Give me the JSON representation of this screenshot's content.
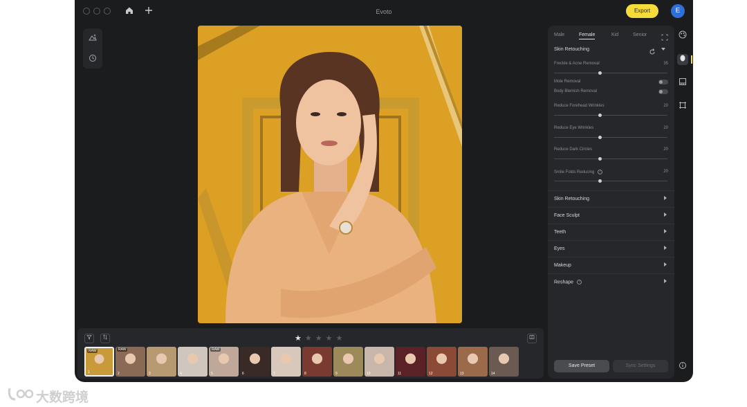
{
  "window": {
    "title": "Evoto",
    "export_label": "Export",
    "avatar_initial": "E"
  },
  "panel": {
    "tabs": [
      {
        "label": "Male",
        "active": false
      },
      {
        "label": "Female",
        "active": true
      },
      {
        "label": "Kid",
        "active": false
      },
      {
        "label": "Senior",
        "active": false
      }
    ],
    "section_title": "Skin Retouching",
    "sliders": [
      {
        "label": "Freckle & Acne Removal",
        "value": "35",
        "level": 0.4
      },
      {
        "label": "Reduce Forehead Wrinkles",
        "value": "20",
        "level": 0.4
      },
      {
        "label": "Reduce Eye Wrinkles",
        "value": "20",
        "level": 0.4
      },
      {
        "label": "Reduce Dark Circles",
        "value": "20",
        "level": 0.4
      },
      {
        "label": "Smile Folds Reducing",
        "value": "20",
        "level": 0.4
      }
    ],
    "toggles": [
      {
        "label": "Mole Removal",
        "on": false
      },
      {
        "label": "Body Blemish Removal",
        "on": false
      }
    ],
    "groups": [
      {
        "label": "Skin Retouching"
      },
      {
        "label": "Face Sculpt"
      },
      {
        "label": "Teeth"
      },
      {
        "label": "Eyes"
      },
      {
        "label": "Makeup"
      },
      {
        "label": "Reshape"
      }
    ],
    "save_preset_label": "Save Preset",
    "sync_settings_label": "Sync Settings"
  },
  "filmstrip": {
    "rating": 1,
    "rating_max": 5,
    "thumbnails": [
      {
        "num": "1",
        "badge": "RAW",
        "selected": true,
        "color": "#c99a3a"
      },
      {
        "num": "2",
        "badge": "RAW",
        "selected": false,
        "color": "#8a6a55"
      },
      {
        "num": "3",
        "badge": "",
        "selected": false,
        "color": "#b89a72"
      },
      {
        "num": "4",
        "badge": "",
        "selected": false,
        "color": "#cfc6bd"
      },
      {
        "num": "5",
        "badge": "RAW",
        "selected": false,
        "color": "#bfa89a"
      },
      {
        "num": "6",
        "badge": "",
        "selected": false,
        "color": "#3a2a26"
      },
      {
        "num": "7",
        "badge": "",
        "selected": false,
        "color": "#d8c8bc"
      },
      {
        "num": "8",
        "badge": "",
        "selected": false,
        "color": "#7a3a32"
      },
      {
        "num": "9",
        "badge": "",
        "selected": false,
        "color": "#9c8a5a"
      },
      {
        "num": "10",
        "badge": "",
        "selected": false,
        "color": "#c8b6aa"
      },
      {
        "num": "11",
        "badge": "",
        "selected": false,
        "color": "#5a2226"
      },
      {
        "num": "12",
        "badge": "",
        "selected": false,
        "color": "#8a4a36"
      },
      {
        "num": "13",
        "badge": "",
        "selected": false,
        "color": "#9a6a4a"
      },
      {
        "num": "14",
        "badge": "",
        "selected": false,
        "color": "#6a5a52"
      }
    ]
  },
  "watermark": {
    "text": "大数跨境"
  },
  "colors": {
    "accent_export": "#f5dc3a",
    "avatar_bg": "#2f6fdc",
    "background": "#1b1c1e",
    "panel": "#26272b",
    "photo_backdrop": "#dca025"
  }
}
